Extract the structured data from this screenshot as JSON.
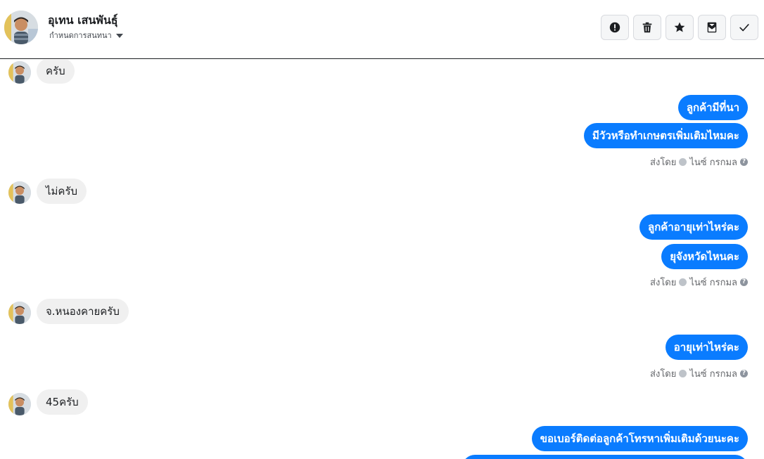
{
  "header": {
    "contact_name": "อุเทน เสนพันธุ์",
    "assign_label": "กำหนดการสนทนา",
    "actions": [
      {
        "name": "spam",
        "icon": "exclamation-circle-icon"
      },
      {
        "name": "delete",
        "icon": "trash-icon"
      },
      {
        "name": "star",
        "icon": "star-icon"
      },
      {
        "name": "mark-unread",
        "icon": "envelope-icon"
      },
      {
        "name": "done",
        "icon": "check-icon"
      }
    ]
  },
  "messages": [
    {
      "direction": "in",
      "text": "ครับ"
    },
    {
      "direction": "out",
      "text": "ลูกค้ามีที่นา"
    },
    {
      "direction": "out",
      "text": "มีวัวหรือทำเกษตรเพิ่มเติมไหมคะ"
    },
    {
      "direction": "status",
      "sent_by": "ส่งโดย",
      "agent": "ไนซ์ กรกมล"
    },
    {
      "direction": "in",
      "text": "ไม่ครับ"
    },
    {
      "direction": "out",
      "text": "ลูกค้าอายุเท่าไหร่คะ"
    },
    {
      "direction": "out",
      "text": "ยุจังหวัดไหนคะ"
    },
    {
      "direction": "status",
      "sent_by": "ส่งโดย",
      "agent": "ไนซ์ กรกมล"
    },
    {
      "direction": "in",
      "text": "จ.หนองคายครับ"
    },
    {
      "direction": "out",
      "text": "อายุเท่าไหร่คะ"
    },
    {
      "direction": "status",
      "sent_by": "ส่งโดย",
      "agent": "ไนซ์ กรกมล"
    },
    {
      "direction": "in",
      "text": "45ครับ"
    },
    {
      "direction": "out",
      "text": "ขอเบอร์ติดต่อลูกค้าโทรหาเพิ่มเติมด้วยนะคะ"
    }
  ],
  "colors": {
    "outgoing_bubble": "#0a7cff",
    "incoming_bubble": "#f0f0f0",
    "meta_text": "#65676b"
  }
}
